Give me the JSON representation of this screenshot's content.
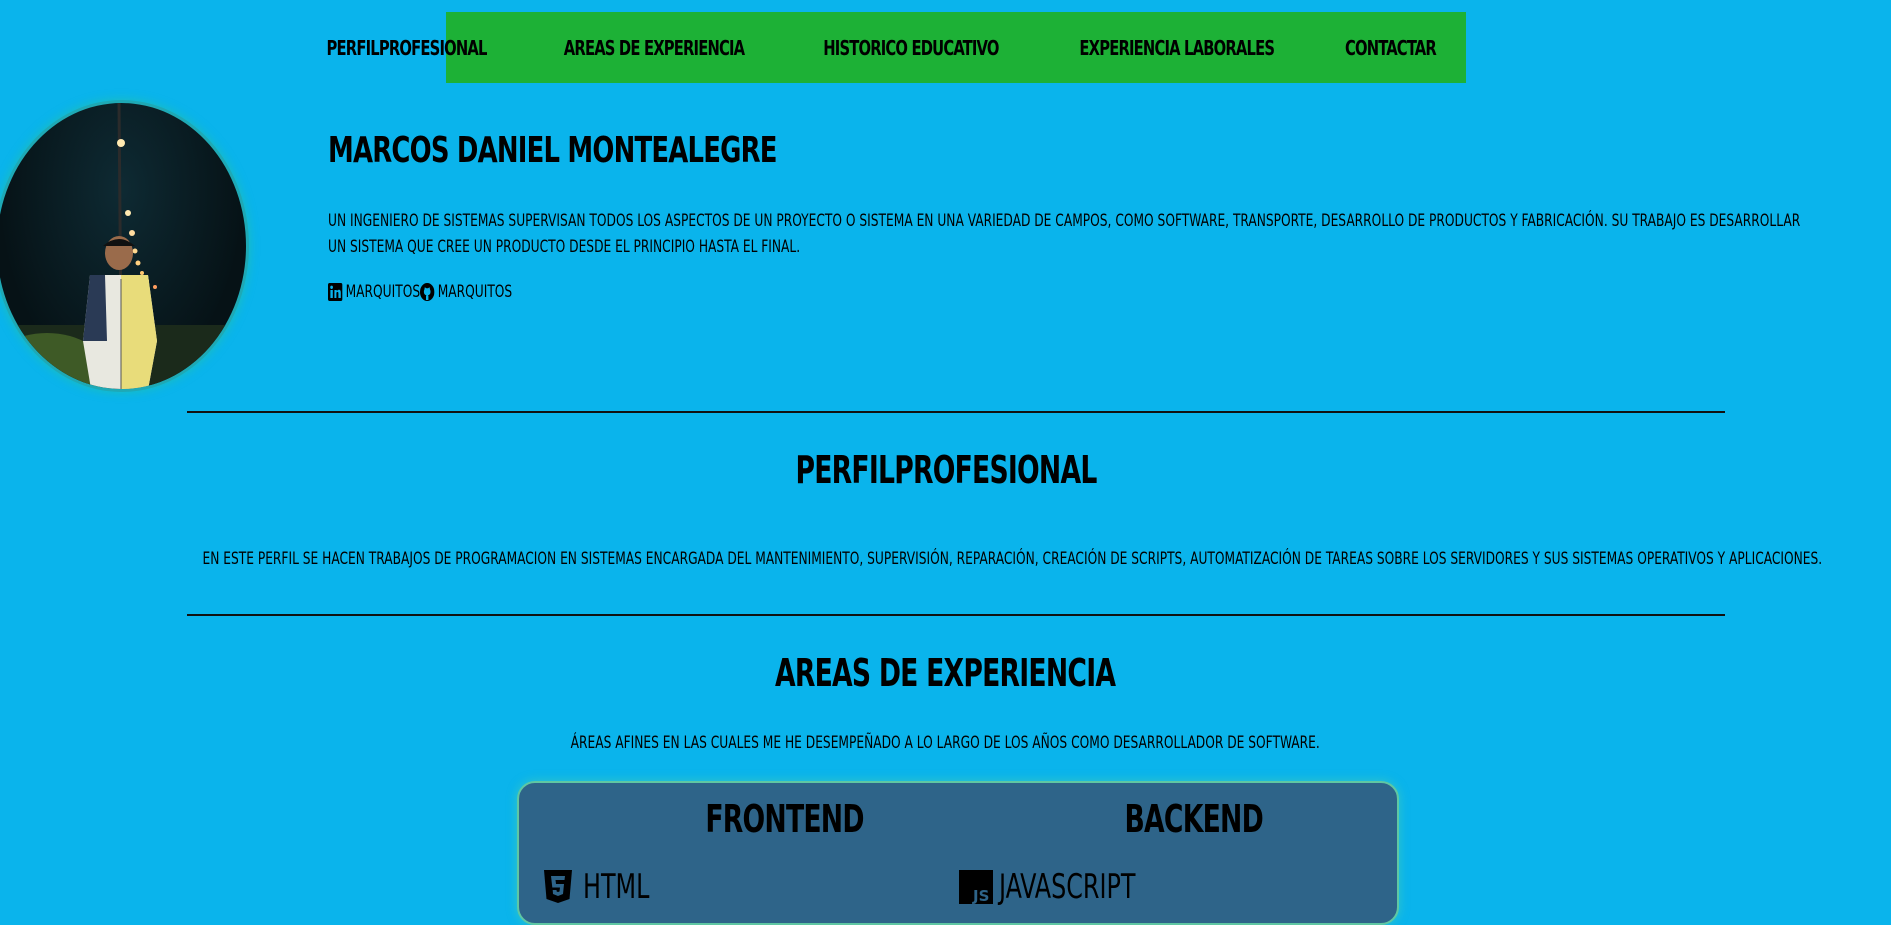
{
  "nav": {
    "items": [
      {
        "label": "PERFILPROFESIONAL"
      },
      {
        "label": "AREAS DE EXPERIENCIA"
      },
      {
        "label": "HISTORICO EDUCATIVO"
      },
      {
        "label": "EXPERIENCIA LABORALES"
      },
      {
        "label": "CONTACTAR"
      }
    ]
  },
  "header": {
    "name": "MARCOS DANIEL MONTEALEGRE",
    "description": "UN INGENIERO DE SISTEMAS SUPERVISAN TODOS LOS ASPECTOS DE UN PROYECTO O SISTEMA EN UNA VARIEDAD DE CAMPOS, COMO SOFTWARE, TRANSPORTE, DESARROLLO DE PRODUCTOS Y FABRICACIÓN. SU TRABAJO ES DESARROLLAR UN SISTEMA QUE CREE UN PRODUCTO DESDE EL PRINCIPIO HASTA EL FINAL.",
    "social": [
      {
        "icon": "linkedin-icon",
        "label": "MARQUITOS"
      },
      {
        "icon": "github-icon",
        "label": "MARQUITOS"
      }
    ]
  },
  "perfil": {
    "title": "PERFILPROFESIONAL",
    "text": "EN ESTE PERFIL SE HACEN TRABAJOS DE PROGRAMACION EN SISTEMAS ENCARGADA DEL MANTENIMIENTO, SUPERVISIÓN, REPARACIÓN, CREACIÓN DE SCRIPTS, AUTOMATIZACIÓN DE TAREAS SOBRE LOS SERVIDORES Y SUS SISTEMAS OPERATIVOS Y APLICACIONES."
  },
  "areas": {
    "title": "AREAS DE EXPERIENCIA",
    "text": "ÁREAS AFINES EN LAS CUALES ME HE DESEMPEÑADO A LO LARGO DE LOS AÑOS COMO DESARROLLADOR DE SOFTWARE.",
    "frontend": {
      "title": "FRONTEND",
      "skills": [
        {
          "icon": "html5-icon",
          "label": "HTML"
        }
      ]
    },
    "backend": {
      "title": "BACKEND",
      "skills": [
        {
          "icon": "javascript-icon",
          "label": "JAVASCRIPT"
        }
      ]
    }
  },
  "colors": {
    "background": "#0ab4ec",
    "nav": "#1db136",
    "card": "#2e6489"
  }
}
